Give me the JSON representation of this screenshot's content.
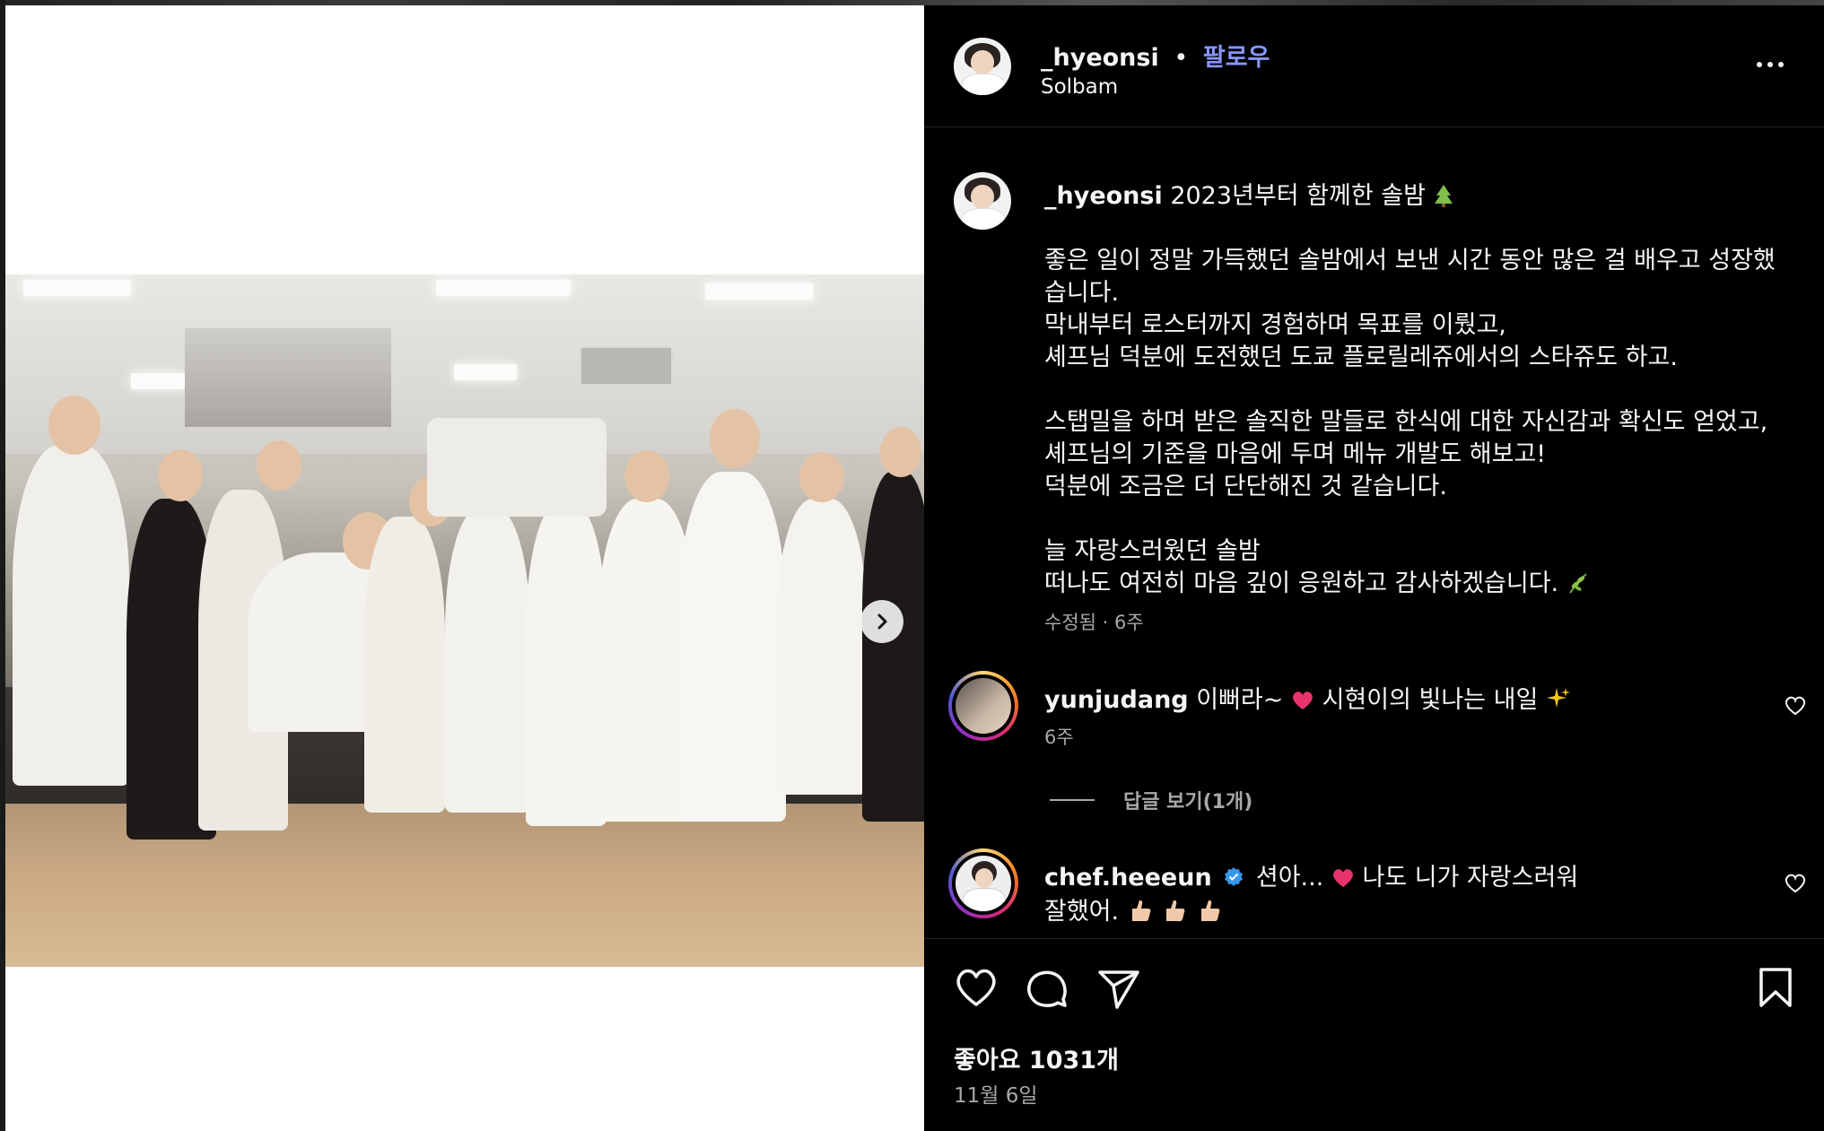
{
  "post": {
    "username": "_hyeonsi",
    "separator": "•",
    "follow_label": "팔로우",
    "location": "Solbam",
    "more_label": "•••",
    "caption_head": "2023년부터 함께한 솔밤",
    "caption_lines": [
      "좋은 일이 정말 가득했던 솔밤에서 보낸 시간 동안 많은 걸 배우고 성장했",
      "습니다.",
      "막내부터 로스터까지 경험하며 목표를 이뤘고,",
      "셰프님 덕분에 도전했던 도쿄 플로릴레쥬에서의 스타쥬도 하고.",
      "",
      "스탭밀을 하며 받은 솔직한 말들로 한식에 대한 자신감과 확신도 얻었고,",
      "셰프님의 기준을 마음에 두며 메뉴 개발도 해보고!",
      "덕분에 조금은 더 단단해진 것 같습니다.",
      "",
      "늘 자랑스러웠던 솔밤",
      "떠나도 여전히 마음 깊이 응원하고 감사하겠습니다."
    ],
    "caption_meta": "수정됨 · 6주"
  },
  "comments": [
    {
      "username": "yunjudang",
      "text_a": "이뻐라~",
      "text_b": "시현이의 빛나는 내일",
      "time": "6주",
      "replies_label": "답글 보기(1개)"
    },
    {
      "username": "chef.heeeun",
      "text_a": "션아...",
      "text_b": "나도 니가 자랑스러워",
      "line2": "잘했어."
    }
  ],
  "actions": {
    "likes_label": "좋아요 1031개",
    "date_label": "11월 6일"
  },
  "icons": {
    "like": "heart-icon",
    "comment": "comment-bubble-icon",
    "share": "paper-plane-icon",
    "save": "bookmark-icon",
    "next": "chevron-right-icon",
    "more": "more-options-icon"
  },
  "colors": {
    "panel_bg": "#000000",
    "follow": "#8796ff",
    "muted": "#a8a8a8",
    "heart_emoji": "#e8336b"
  }
}
